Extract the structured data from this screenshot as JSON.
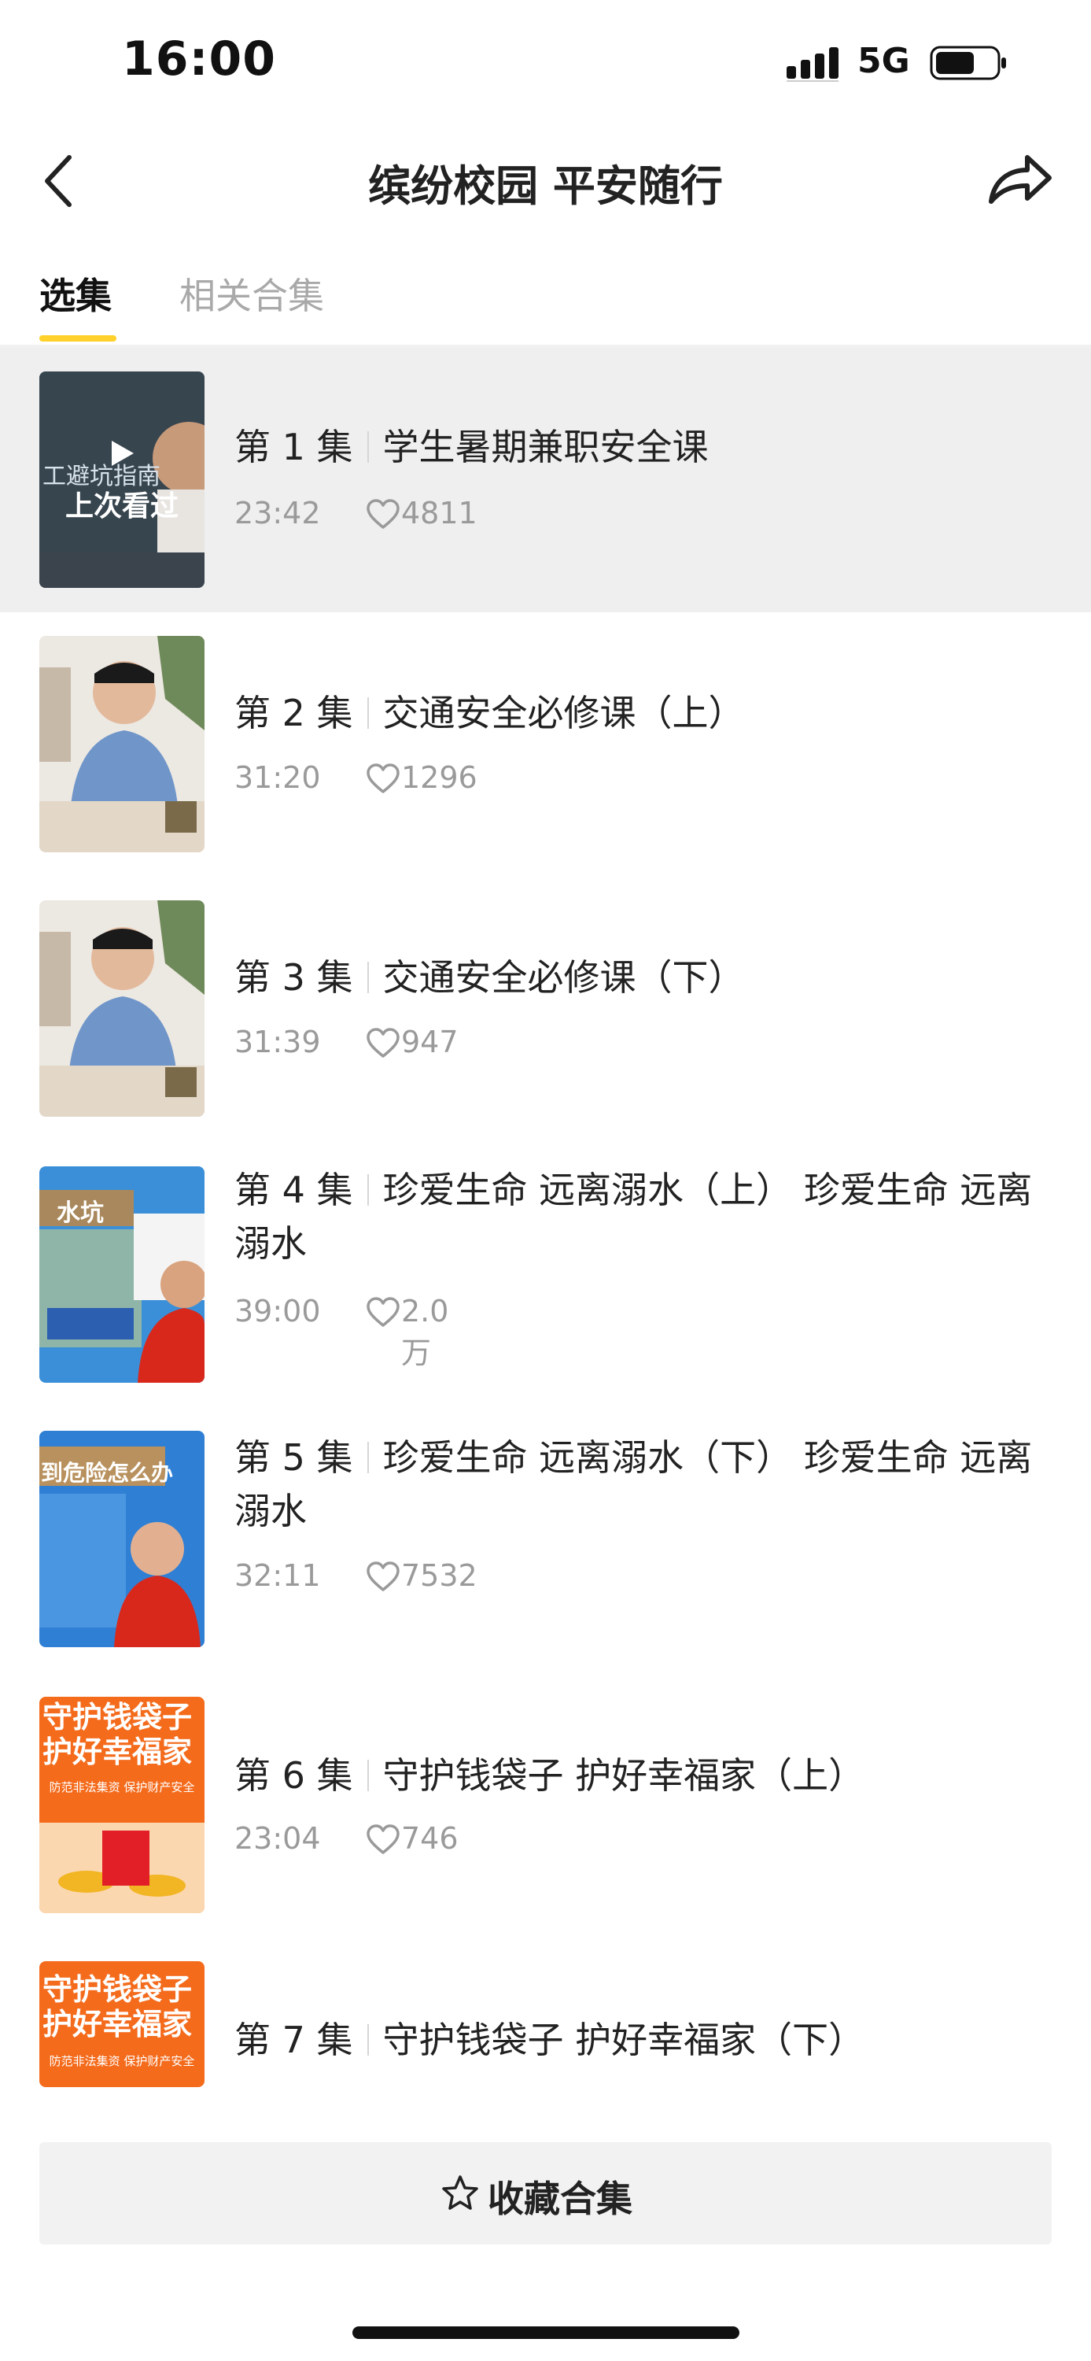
{
  "status_bar": {
    "time": "16:00",
    "network": "5G"
  },
  "header": {
    "title": "缤纷校园 平安随行",
    "back_icon": "chevron-left-icon",
    "share_icon": "share-icon"
  },
  "tabs": [
    {
      "label": "选集",
      "active": true
    },
    {
      "label": "相关合集",
      "active": false
    }
  ],
  "episodes": [
    {
      "num": "第 1 集",
      "title": "学生暑期兼职安全课",
      "duration": "23:42",
      "likes": "4811",
      "last_watched": "上次看过",
      "thumb_text": "工避坑指南"
    },
    {
      "num": "第 2 集",
      "title": "交通安全必修课（上）",
      "duration": "31:20",
      "likes": "1296"
    },
    {
      "num": "第 3 集",
      "title": "交通安全必修课（下）",
      "duration": "31:39",
      "likes": "947"
    },
    {
      "num": "第 4 集",
      "title": "珍爱生命 远离溺水（上） 珍爱生命 远离溺水",
      "duration": "39:00",
      "likes": "2.0万",
      "thumb_text": "水坑"
    },
    {
      "num": "第 5 集",
      "title": "珍爱生命 远离溺水（下） 珍爱生命 远离溺水",
      "duration": "32:11",
      "likes": "7532",
      "thumb_text": "到危险怎么办"
    },
    {
      "num": "第 6 集",
      "title": "守护钱袋子 护好幸福家（上）",
      "duration": "23:04",
      "likes": "746",
      "thumb_text": "守护钱袋子",
      "thumb_text2": "护好幸福家",
      "thumb_sub": "防范非法集资 保护财产安全"
    },
    {
      "num": "第 7 集",
      "title": "守护钱袋子 护好幸福家（下）",
      "thumb_text": "守护钱袋子",
      "thumb_text2": "护好幸福家",
      "thumb_sub": "防范非法集资 保护财产安全"
    }
  ],
  "bottom": {
    "favorite_label": "收藏合集"
  },
  "colors": {
    "accent": "#ffd12a",
    "highlight_bg": "#efefef",
    "meta": "#9a9a9a"
  }
}
